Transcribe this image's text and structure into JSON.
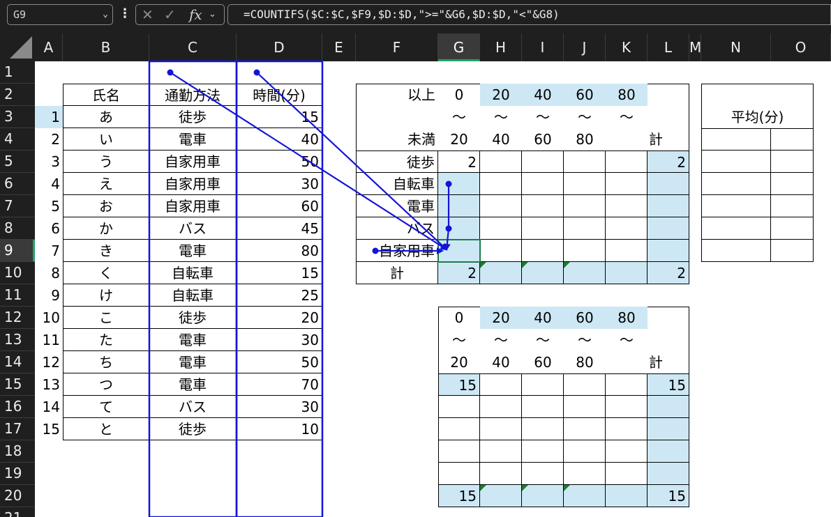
{
  "formula_bar": {
    "name_box": "G9",
    "cancel_icon": "✕",
    "enter_icon": "✓",
    "fx_label": "fx",
    "formula": "=COUNTIFS($C:$C,$F9,$D:$D,\">=\"&G6,$D:$D,\"<\"&G8)"
  },
  "columns": [
    "A",
    "B",
    "C",
    "D",
    "E",
    "F",
    "G",
    "H",
    "I",
    "J",
    "K",
    "L",
    "M",
    "N",
    "O"
  ],
  "selected_column": "G",
  "rows": [
    "1",
    "2",
    "3",
    "4",
    "5",
    "6",
    "7",
    "8",
    "9",
    "10",
    "11",
    "12",
    "13",
    "14",
    "15",
    "16",
    "17",
    "18",
    "19",
    "20",
    "21"
  ],
  "selected_row": "9",
  "data_table": {
    "headers": [
      "氏名",
      "通勤方法",
      "時間(分)"
    ],
    "rows": [
      {
        "no": "1",
        "name": "あ",
        "method": "徒歩",
        "time": "15"
      },
      {
        "no": "2",
        "name": "い",
        "method": "電車",
        "time": "40"
      },
      {
        "no": "3",
        "name": "う",
        "method": "自家用車",
        "time": "50"
      },
      {
        "no": "4",
        "name": "え",
        "method": "自家用車",
        "time": "30"
      },
      {
        "no": "5",
        "name": "お",
        "method": "自家用車",
        "time": "60"
      },
      {
        "no": "6",
        "name": "か",
        "method": "バス",
        "time": "45"
      },
      {
        "no": "7",
        "name": "き",
        "method": "電車",
        "time": "80"
      },
      {
        "no": "8",
        "name": "く",
        "method": "自転車",
        "time": "15"
      },
      {
        "no": "9",
        "name": "け",
        "method": "自転車",
        "time": "25"
      },
      {
        "no": "10",
        "name": "こ",
        "method": "徒歩",
        "time": "20"
      },
      {
        "no": "11",
        "name": "た",
        "method": "電車",
        "time": "30"
      },
      {
        "no": "12",
        "name": "ち",
        "method": "電車",
        "time": "50"
      },
      {
        "no": "13",
        "name": "つ",
        "method": "電車",
        "time": "70"
      },
      {
        "no": "14",
        "name": "て",
        "method": "バス",
        "time": "30"
      },
      {
        "no": "15",
        "name": "と",
        "method": "徒歩",
        "time": "10"
      }
    ]
  },
  "count_table": {
    "label_lower": "以上",
    "label_tilde": "～",
    "label_upper": "未満",
    "lower_bounds": [
      "0",
      "20",
      "40",
      "60",
      "80"
    ],
    "upper_bounds": [
      "20",
      "40",
      "60",
      "80",
      ""
    ],
    "total_label": "計",
    "categories": [
      "徒歩",
      "自転車",
      "電車",
      "バス",
      "自家用車"
    ],
    "first_row": {
      "g": "2",
      "total": "2"
    },
    "totals": {
      "g": "2",
      "total": "2"
    }
  },
  "average_table": {
    "title": "平均(分)"
  },
  "sum_table": {
    "lower_bounds": [
      "0",
      "20",
      "40",
      "60",
      "80"
    ],
    "upper_bounds": [
      "20",
      "40",
      "60",
      "80",
      ""
    ],
    "tilde": "～",
    "total_label": "計",
    "first_row": {
      "g": "15",
      "total": "15"
    },
    "totals": {
      "g": "15",
      "total": "15"
    }
  },
  "colors": {
    "header_bg": "#1f1f1f",
    "highlight_fill": "#cde8f4",
    "trace_arrow": "#1414d8",
    "selection": "#21a366"
  }
}
